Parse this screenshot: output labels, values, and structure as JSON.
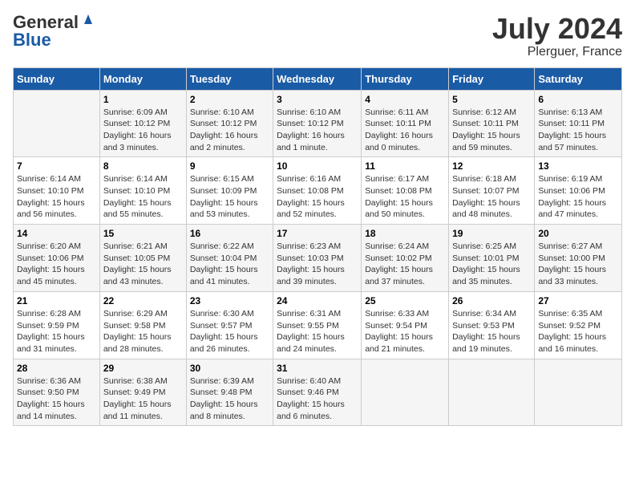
{
  "header": {
    "logo_general": "General",
    "logo_blue": "Blue",
    "month_year": "July 2024",
    "location": "Plerguer, France"
  },
  "days_of_week": [
    "Sunday",
    "Monday",
    "Tuesday",
    "Wednesday",
    "Thursday",
    "Friday",
    "Saturday"
  ],
  "weeks": [
    [
      {
        "day": "",
        "sunrise": "",
        "sunset": "",
        "daylight": ""
      },
      {
        "day": "1",
        "sunrise": "Sunrise: 6:09 AM",
        "sunset": "Sunset: 10:12 PM",
        "daylight": "Daylight: 16 hours and 3 minutes."
      },
      {
        "day": "2",
        "sunrise": "Sunrise: 6:10 AM",
        "sunset": "Sunset: 10:12 PM",
        "daylight": "Daylight: 16 hours and 2 minutes."
      },
      {
        "day": "3",
        "sunrise": "Sunrise: 6:10 AM",
        "sunset": "Sunset: 10:12 PM",
        "daylight": "Daylight: 16 hours and 1 minute."
      },
      {
        "day": "4",
        "sunrise": "Sunrise: 6:11 AM",
        "sunset": "Sunset: 10:11 PM",
        "daylight": "Daylight: 16 hours and 0 minutes."
      },
      {
        "day": "5",
        "sunrise": "Sunrise: 6:12 AM",
        "sunset": "Sunset: 10:11 PM",
        "daylight": "Daylight: 15 hours and 59 minutes."
      },
      {
        "day": "6",
        "sunrise": "Sunrise: 6:13 AM",
        "sunset": "Sunset: 10:11 PM",
        "daylight": "Daylight: 15 hours and 57 minutes."
      }
    ],
    [
      {
        "day": "7",
        "sunrise": "Sunrise: 6:14 AM",
        "sunset": "Sunset: 10:10 PM",
        "daylight": "Daylight: 15 hours and 56 minutes."
      },
      {
        "day": "8",
        "sunrise": "Sunrise: 6:14 AM",
        "sunset": "Sunset: 10:10 PM",
        "daylight": "Daylight: 15 hours and 55 minutes."
      },
      {
        "day": "9",
        "sunrise": "Sunrise: 6:15 AM",
        "sunset": "Sunset: 10:09 PM",
        "daylight": "Daylight: 15 hours and 53 minutes."
      },
      {
        "day": "10",
        "sunrise": "Sunrise: 6:16 AM",
        "sunset": "Sunset: 10:08 PM",
        "daylight": "Daylight: 15 hours and 52 minutes."
      },
      {
        "day": "11",
        "sunrise": "Sunrise: 6:17 AM",
        "sunset": "Sunset: 10:08 PM",
        "daylight": "Daylight: 15 hours and 50 minutes."
      },
      {
        "day": "12",
        "sunrise": "Sunrise: 6:18 AM",
        "sunset": "Sunset: 10:07 PM",
        "daylight": "Daylight: 15 hours and 48 minutes."
      },
      {
        "day": "13",
        "sunrise": "Sunrise: 6:19 AM",
        "sunset": "Sunset: 10:06 PM",
        "daylight": "Daylight: 15 hours and 47 minutes."
      }
    ],
    [
      {
        "day": "14",
        "sunrise": "Sunrise: 6:20 AM",
        "sunset": "Sunset: 10:06 PM",
        "daylight": "Daylight: 15 hours and 45 minutes."
      },
      {
        "day": "15",
        "sunrise": "Sunrise: 6:21 AM",
        "sunset": "Sunset: 10:05 PM",
        "daylight": "Daylight: 15 hours and 43 minutes."
      },
      {
        "day": "16",
        "sunrise": "Sunrise: 6:22 AM",
        "sunset": "Sunset: 10:04 PM",
        "daylight": "Daylight: 15 hours and 41 minutes."
      },
      {
        "day": "17",
        "sunrise": "Sunrise: 6:23 AM",
        "sunset": "Sunset: 10:03 PM",
        "daylight": "Daylight: 15 hours and 39 minutes."
      },
      {
        "day": "18",
        "sunrise": "Sunrise: 6:24 AM",
        "sunset": "Sunset: 10:02 PM",
        "daylight": "Daylight: 15 hours and 37 minutes."
      },
      {
        "day": "19",
        "sunrise": "Sunrise: 6:25 AM",
        "sunset": "Sunset: 10:01 PM",
        "daylight": "Daylight: 15 hours and 35 minutes."
      },
      {
        "day": "20",
        "sunrise": "Sunrise: 6:27 AM",
        "sunset": "Sunset: 10:00 PM",
        "daylight": "Daylight: 15 hours and 33 minutes."
      }
    ],
    [
      {
        "day": "21",
        "sunrise": "Sunrise: 6:28 AM",
        "sunset": "Sunset: 9:59 PM",
        "daylight": "Daylight: 15 hours and 31 minutes."
      },
      {
        "day": "22",
        "sunrise": "Sunrise: 6:29 AM",
        "sunset": "Sunset: 9:58 PM",
        "daylight": "Daylight: 15 hours and 28 minutes."
      },
      {
        "day": "23",
        "sunrise": "Sunrise: 6:30 AM",
        "sunset": "Sunset: 9:57 PM",
        "daylight": "Daylight: 15 hours and 26 minutes."
      },
      {
        "day": "24",
        "sunrise": "Sunrise: 6:31 AM",
        "sunset": "Sunset: 9:55 PM",
        "daylight": "Daylight: 15 hours and 24 minutes."
      },
      {
        "day": "25",
        "sunrise": "Sunrise: 6:33 AM",
        "sunset": "Sunset: 9:54 PM",
        "daylight": "Daylight: 15 hours and 21 minutes."
      },
      {
        "day": "26",
        "sunrise": "Sunrise: 6:34 AM",
        "sunset": "Sunset: 9:53 PM",
        "daylight": "Daylight: 15 hours and 19 minutes."
      },
      {
        "day": "27",
        "sunrise": "Sunrise: 6:35 AM",
        "sunset": "Sunset: 9:52 PM",
        "daylight": "Daylight: 15 hours and 16 minutes."
      }
    ],
    [
      {
        "day": "28",
        "sunrise": "Sunrise: 6:36 AM",
        "sunset": "Sunset: 9:50 PM",
        "daylight": "Daylight: 15 hours and 14 minutes."
      },
      {
        "day": "29",
        "sunrise": "Sunrise: 6:38 AM",
        "sunset": "Sunset: 9:49 PM",
        "daylight": "Daylight: 15 hours and 11 minutes."
      },
      {
        "day": "30",
        "sunrise": "Sunrise: 6:39 AM",
        "sunset": "Sunset: 9:48 PM",
        "daylight": "Daylight: 15 hours and 8 minutes."
      },
      {
        "day": "31",
        "sunrise": "Sunrise: 6:40 AM",
        "sunset": "Sunset: 9:46 PM",
        "daylight": "Daylight: 15 hours and 6 minutes."
      },
      {
        "day": "",
        "sunrise": "",
        "sunset": "",
        "daylight": ""
      },
      {
        "day": "",
        "sunrise": "",
        "sunset": "",
        "daylight": ""
      },
      {
        "day": "",
        "sunrise": "",
        "sunset": "",
        "daylight": ""
      }
    ]
  ]
}
